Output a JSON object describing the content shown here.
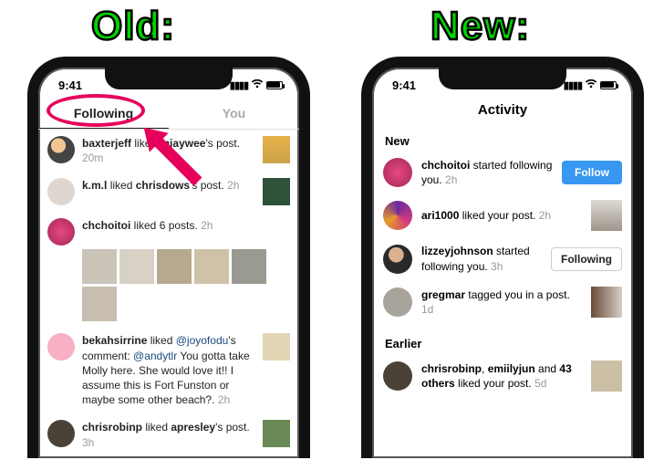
{
  "labels": {
    "old": "Old:",
    "new": "New:"
  },
  "status": {
    "time": "9:41"
  },
  "left": {
    "tabs": {
      "following": "Following",
      "you": "You"
    },
    "items": [
      {
        "user": "baxterjeff",
        "rest": " liked ",
        "target": "miaywee",
        "tail": "'s post.",
        "time": "20m"
      },
      {
        "user": "k.m.l",
        "rest": " liked ",
        "target": "chrisdows",
        "tail": "'s post.",
        "time": "2h"
      },
      {
        "user": "chchoitoi",
        "rest": " liked 6 posts.",
        "time": "2h"
      },
      {
        "user": "bekahsirrine",
        "rest": " liked ",
        "mention": "@joyofodu",
        "tail": "'s comment: ",
        "mention2": "@andytlr",
        "body": " You gotta take Molly here. She would love it!! I assume this is Fort Funston or maybe some other beach?. ",
        "time": "2h"
      },
      {
        "user": "chrisrobinp",
        "rest": " liked ",
        "target": "apresley",
        "tail": "'s post.",
        "time": "3h"
      }
    ]
  },
  "right": {
    "title": "Activity",
    "section_new": "New",
    "section_earlier": "Earlier",
    "follow_btn": "Follow",
    "following_btn": "Following",
    "items": [
      {
        "user": "chchoitoi",
        "rest": " started following you. ",
        "time": "2h"
      },
      {
        "user": "ari1000",
        "rest": " liked your post. ",
        "time": "2h"
      },
      {
        "user": "lizzeyjohnson",
        "rest": " started following you. ",
        "time": "3h"
      },
      {
        "user": "gregmar",
        "rest": " tagged you in a post. ",
        "time": "1d"
      }
    ],
    "earlier": {
      "user1": "chrisrobinp",
      "sep": ", ",
      "user2": "emiilyjun",
      "tail": " and ",
      "count": "43 others",
      "rest": " liked your post. ",
      "time": "5d"
    }
  }
}
